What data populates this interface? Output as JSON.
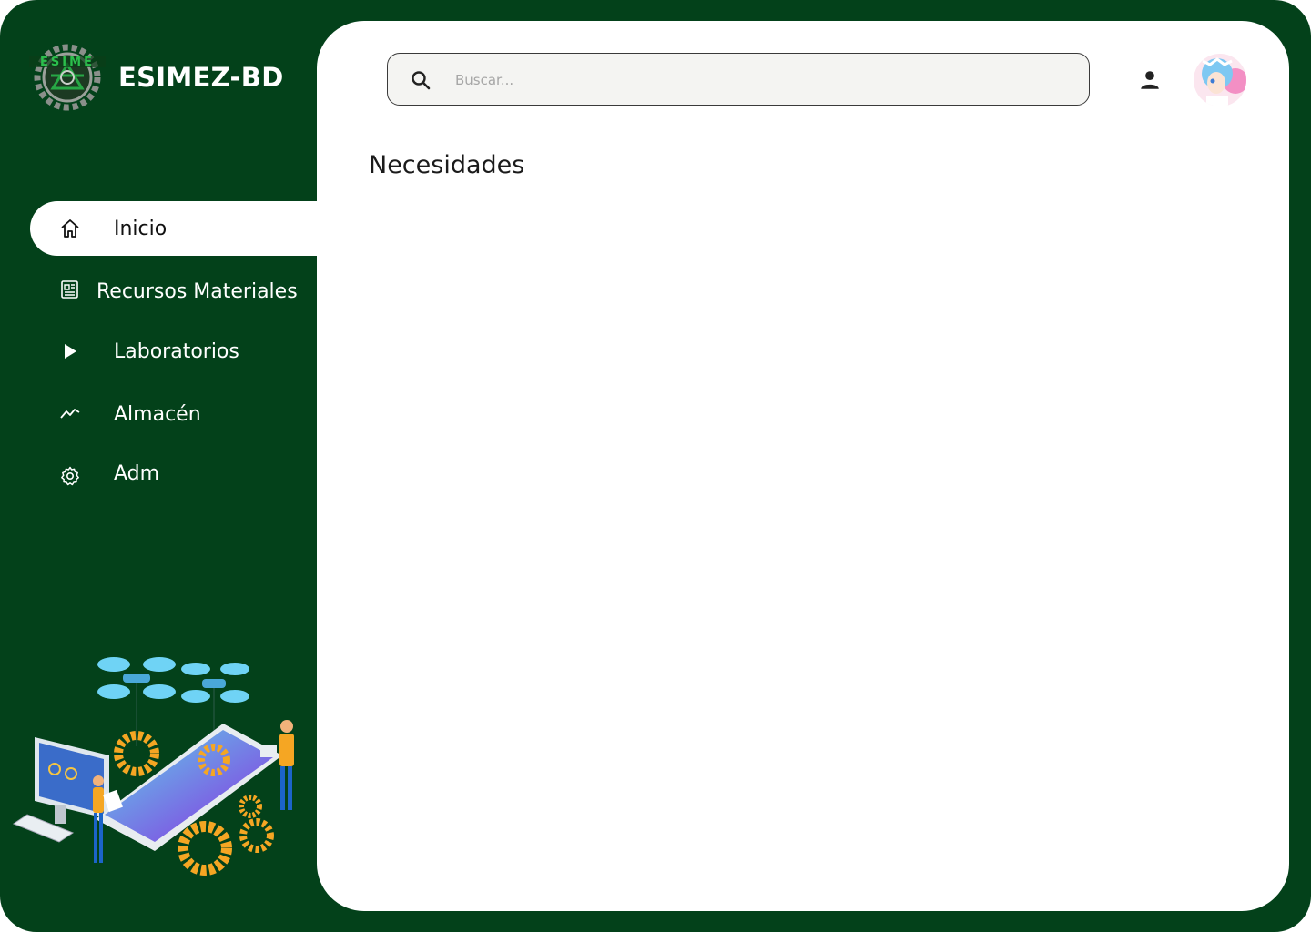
{
  "brand": {
    "name": "ESIMEZ-BD",
    "logo_icon": "esime-gear-logo-icon"
  },
  "sidebar": {
    "items": [
      {
        "label": "Inicio",
        "icon": "home-icon",
        "active": true
      },
      {
        "label": "Recursos Materiales",
        "icon": "newspaper-icon",
        "active": false
      },
      {
        "label": "Laboratorios",
        "icon": "play-icon",
        "active": false
      },
      {
        "label": "Almacén",
        "icon": "trend-line-icon",
        "active": false
      },
      {
        "label": "Adm",
        "icon": "gear-icon",
        "active": false
      }
    ]
  },
  "header": {
    "search": {
      "placeholder": "Buscar...",
      "value": "",
      "icon": "search-icon"
    },
    "user_icon": "user-icon",
    "avatar_icon": "avatar"
  },
  "main": {
    "title": "Necesidades"
  },
  "colors": {
    "sidebar_bg": "#03411a",
    "panel_bg": "#ffffff",
    "search_bg": "#f4f4f2",
    "illustration_accent": "#f5a623"
  }
}
